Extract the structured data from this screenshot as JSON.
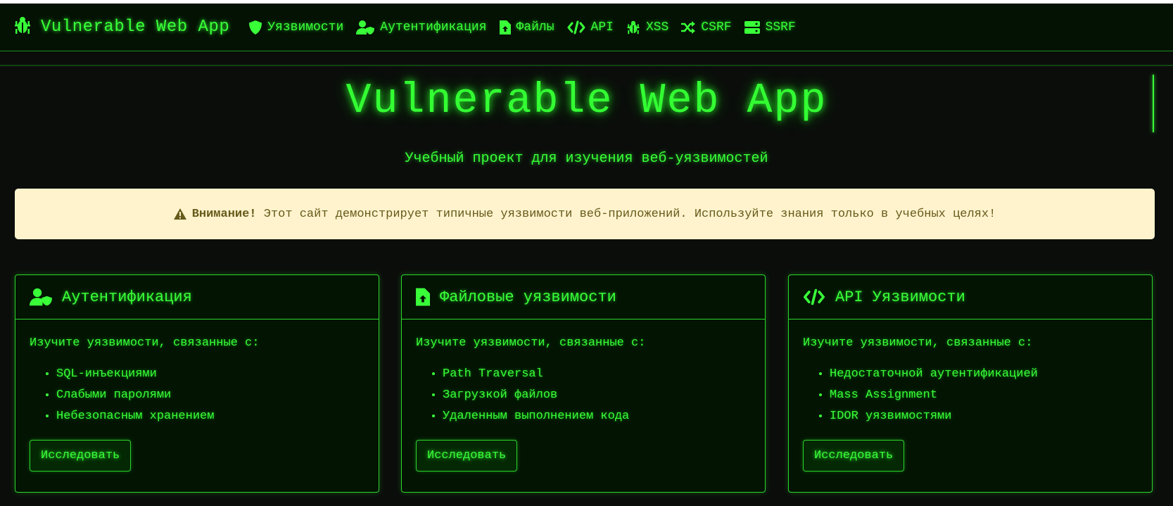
{
  "navbar": {
    "brand": "Vulnerable Web App",
    "items": [
      {
        "label": "Уязвимости",
        "icon": "shield-icon"
      },
      {
        "label": "Аутентификация",
        "icon": "user-shield-icon"
      },
      {
        "label": "Файлы",
        "icon": "file-upload-icon"
      },
      {
        "label": "API",
        "icon": "code-icon"
      },
      {
        "label": "XSS",
        "icon": "bug-icon"
      },
      {
        "label": "CSRF",
        "icon": "random-icon"
      },
      {
        "label": "SSRF",
        "icon": "server-icon"
      }
    ]
  },
  "hero": {
    "title": "Vulnerable Web App",
    "subtitle": "Учебный проект для изучения веб-уязвимостей"
  },
  "alert": {
    "strong": "Внимание!",
    "text": " Этот сайт демонстрирует типичные уязвимости веб-приложений. Используйте знания только в учебных целях!"
  },
  "cards": [
    {
      "title": "Аутентификация",
      "icon": "user-shield-icon",
      "lead": "Изучите уязвимости, связанные с:",
      "items": [
        "SQL-инъекциями",
        "Слабыми паролями",
        "Небезопасным хранением"
      ],
      "button": "Исследовать"
    },
    {
      "title": "Файловые уязвимости",
      "icon": "file-upload-icon",
      "lead": "Изучите уязвимости, связанные с:",
      "items": [
        "Path Traversal",
        "Загрузкой файлов",
        "Удаленным выполнением кода"
      ],
      "button": "Исследовать"
    },
    {
      "title": "API Уязвимости",
      "icon": "code-icon",
      "lead": "Изучите уязвимости, связанные с:",
      "items": [
        "Недостаточной аутентификацией",
        "Mass Assignment",
        "IDOR уязвимостями"
      ],
      "button": "Исследовать"
    }
  ],
  "colors": {
    "accent": "#33ff33",
    "background": "#0b0d0b",
    "card_background": "#031403",
    "alert_background": "#fff3cd",
    "alert_text": "#665a1b"
  }
}
